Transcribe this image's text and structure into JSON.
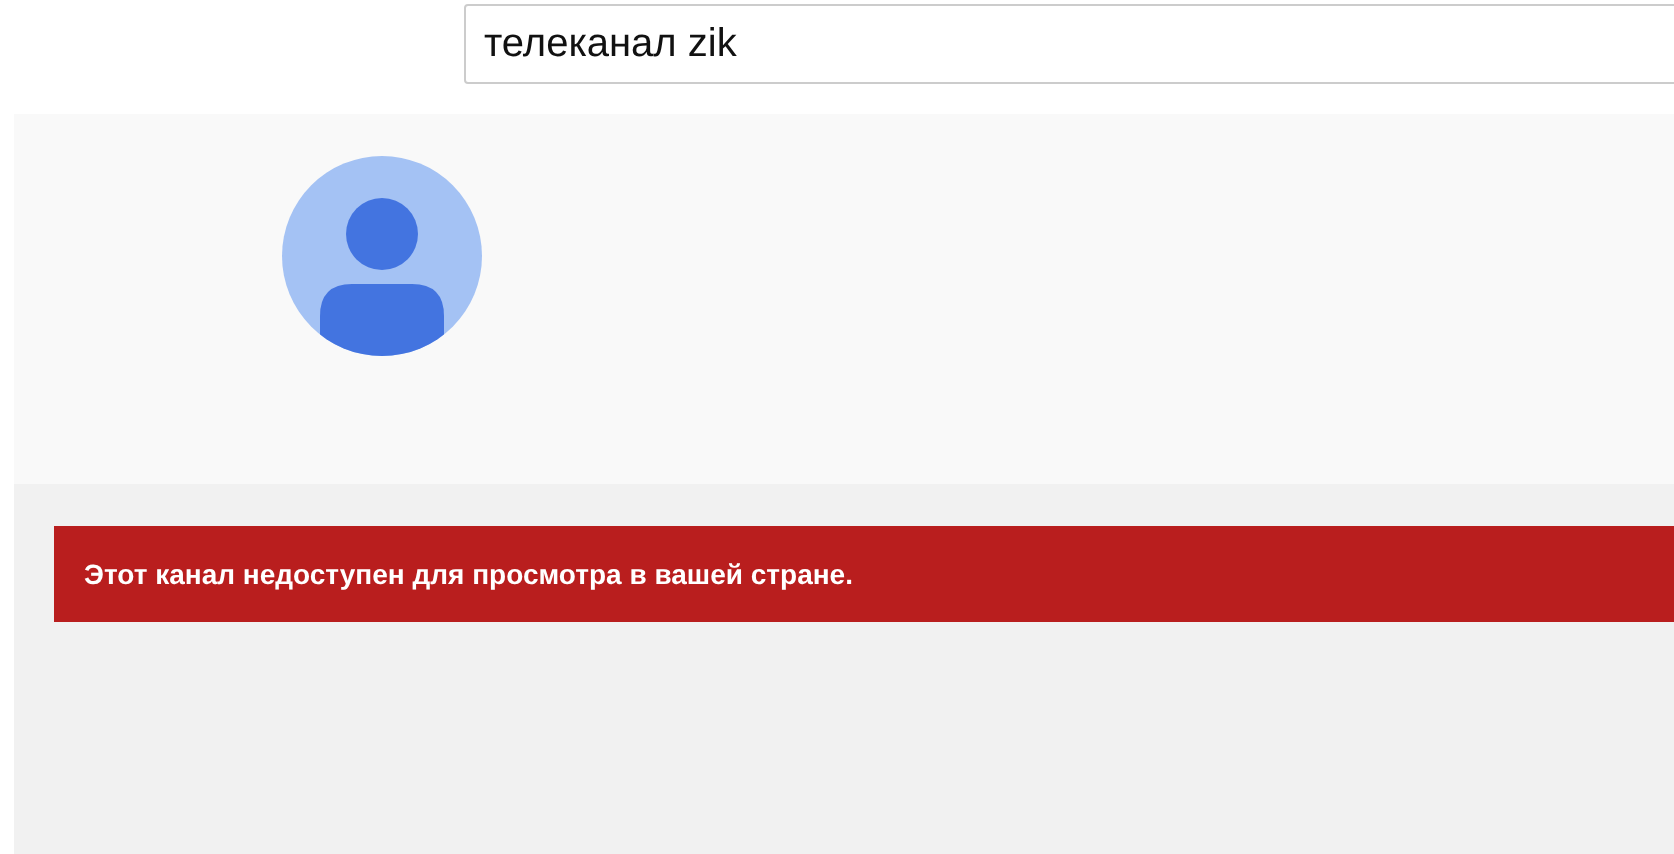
{
  "search": {
    "value": "телеканал zik"
  },
  "channel": {
    "avatar": {
      "kind": "default"
    }
  },
  "alert": {
    "message": "Этот канал недоступен для просмотра в вашей стране."
  }
}
